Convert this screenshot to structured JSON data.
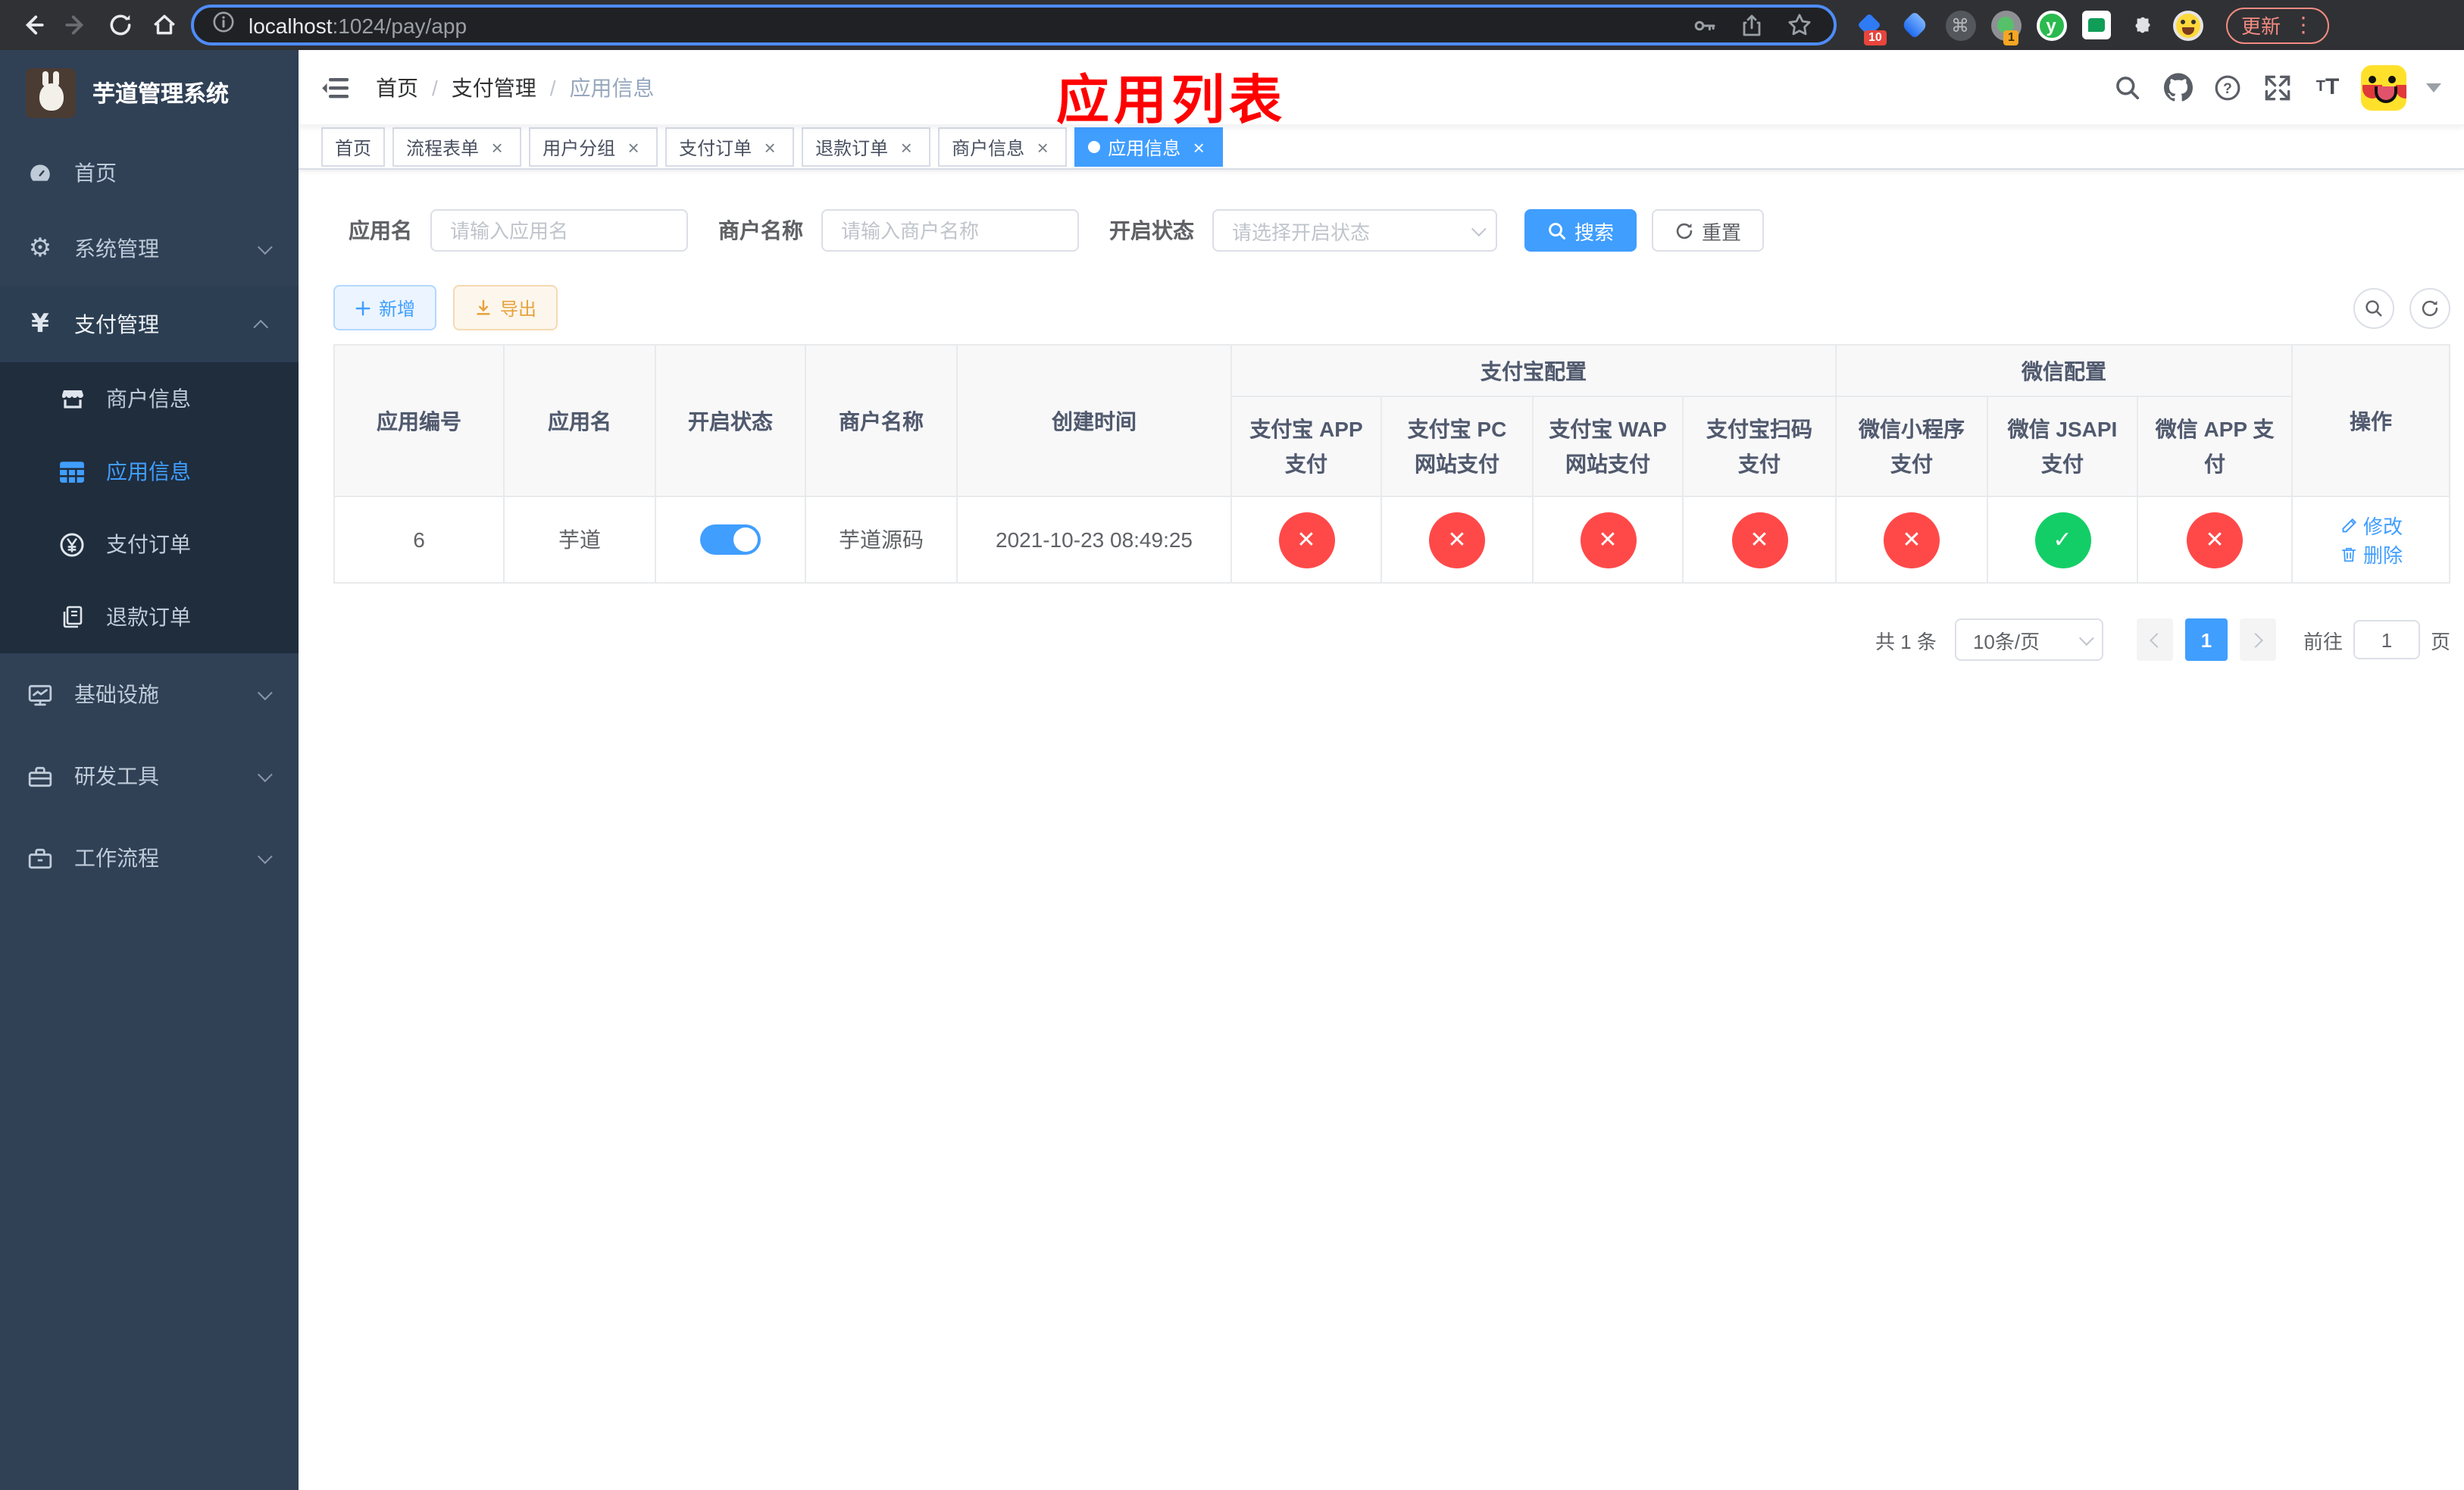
{
  "browser": {
    "url_host": "localhost",
    "url_path": ":1024/pay/app",
    "update_label": "更新",
    "ext_badge_blue": "10",
    "ext_badge_green": "1"
  },
  "sidebar": {
    "title": "芋道管理系统",
    "menu_top": [
      {
        "label": "首页",
        "icon": "dashboard-icon"
      },
      {
        "label": "系统管理",
        "icon": "gear-icon",
        "state": "collapsed"
      },
      {
        "label": "支付管理",
        "icon": "yuan-icon",
        "state": "expanded"
      }
    ],
    "submenu_pay": [
      {
        "label": "商户信息",
        "icon": "shop-icon",
        "selected": false
      },
      {
        "label": "应用信息",
        "icon": "grid-icon",
        "selected": true
      },
      {
        "label": "支付订单",
        "icon": "coin-icon",
        "selected": false
      },
      {
        "label": "退款订单",
        "icon": "refund-doc-icon",
        "selected": false
      }
    ],
    "menu_bottom": [
      {
        "label": "基础设施",
        "icon": "monitor-icon",
        "state": "collapsed"
      },
      {
        "label": "研发工具",
        "icon": "toolbox-icon",
        "state": "collapsed"
      },
      {
        "label": "工作流程",
        "icon": "briefcase-icon",
        "state": "collapsed"
      }
    ]
  },
  "navbar": {
    "breadcrumb": [
      "首页",
      "支付管理",
      "应用信息"
    ],
    "annotation": "应用列表",
    "annotation_color": "#ff0000"
  },
  "tabs": [
    {
      "label": "首页",
      "closable": false,
      "active": false
    },
    {
      "label": "流程表单",
      "closable": true,
      "active": false
    },
    {
      "label": "用户分组",
      "closable": true,
      "active": false
    },
    {
      "label": "支付订单",
      "closable": true,
      "active": false
    },
    {
      "label": "退款订单",
      "closable": true,
      "active": false
    },
    {
      "label": "商户信息",
      "closable": true,
      "active": false
    },
    {
      "label": "应用信息",
      "closable": true,
      "active": true
    }
  ],
  "filters": {
    "app_name": {
      "label": "应用名",
      "placeholder": "请输入应用名",
      "value": ""
    },
    "merchant_name": {
      "label": "商户名称",
      "placeholder": "请输入商户名称",
      "value": ""
    },
    "status": {
      "label": "开启状态",
      "placeholder": "请选择开启状态",
      "value": ""
    },
    "search_label": "搜索",
    "reset_label": "重置"
  },
  "toolbar": {
    "add_label": "新增",
    "export_label": "导出"
  },
  "table": {
    "columns_simple": [
      "应用编号",
      "应用名",
      "开启状态",
      "商户名称",
      "创建时间"
    ],
    "group_alipay": {
      "label": "支付宝配置",
      "children": [
        "支付宝 APP 支付",
        "支付宝 PC 网站支付",
        "支付宝 WAP 网站支付",
        "支付宝扫码支付"
      ]
    },
    "group_wechat": {
      "label": "微信配置",
      "children": [
        "微信小程序支付",
        "微信 JSAPI 支付",
        "微信 APP 支付"
      ]
    },
    "ops_label": "操作",
    "rows": [
      {
        "id": "6",
        "name": "芋道",
        "enabled": "on",
        "merchant": "芋道源码",
        "created": "2021-10-23 08:49:25",
        "pay_status": [
          "off",
          "off",
          "off",
          "off",
          "off",
          "on",
          "off"
        ],
        "edit_label": "修改",
        "delete_label": "删除"
      }
    ]
  },
  "pagination": {
    "total": "共 1 条",
    "page_size": "10条/页",
    "current": "1",
    "goto_label": "前往",
    "goto_value": "1",
    "goto_suffix": "页"
  },
  "colors": {
    "primary": "#409EFF",
    "success": "#13ce66",
    "danger": "#ff4949",
    "warning": "#e6a23c",
    "sidebar_bg": "#304156",
    "submenu_bg": "#1f2d3d"
  }
}
